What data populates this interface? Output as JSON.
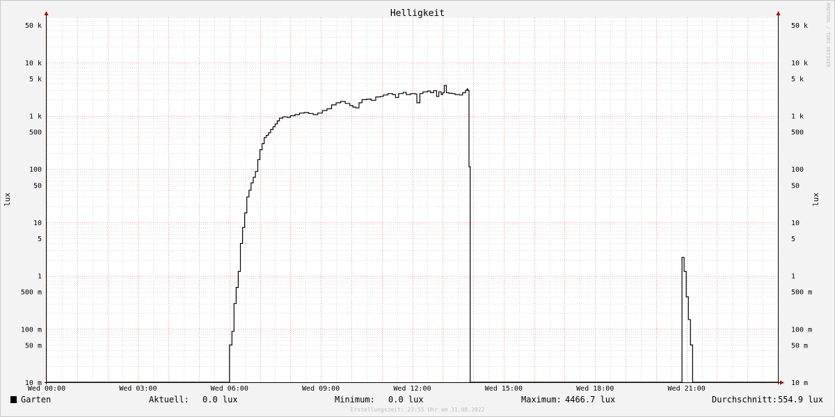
{
  "chart_data": {
    "type": "line",
    "title": "Helligkeit",
    "ylabel": "lux",
    "y_scale": "log",
    "ylim": [
      0.01,
      70000
    ],
    "xlim_hours": [
      0,
      24
    ],
    "x_ticks": [
      {
        "h": 0,
        "label": "Wed 00:00"
      },
      {
        "h": 3,
        "label": "Wed 03:00"
      },
      {
        "h": 6,
        "label": "Wed 06:00"
      },
      {
        "h": 9,
        "label": "Wed 09:00"
      },
      {
        "h": 12,
        "label": "Wed 12:00"
      },
      {
        "h": 15,
        "label": "Wed 15:00"
      },
      {
        "h": 18,
        "label": "Wed 18:00"
      },
      {
        "h": 21,
        "label": "Wed 21:00"
      }
    ],
    "y_ticks": [
      {
        "v": 50000,
        "label": "50 k"
      },
      {
        "v": 10000,
        "label": "10 k"
      },
      {
        "v": 5000,
        "label": "5 k"
      },
      {
        "v": 1000,
        "label": "1 k"
      },
      {
        "v": 500,
        "label": "500"
      },
      {
        "v": 100,
        "label": "100"
      },
      {
        "v": 50,
        "label": "50"
      },
      {
        "v": 10,
        "label": "10"
      },
      {
        "v": 5,
        "label": "5"
      },
      {
        "v": 1,
        "label": "1"
      },
      {
        "v": 0.5,
        "label": "500 m"
      },
      {
        "v": 0.1,
        "label": "100 m"
      },
      {
        "v": 0.05,
        "label": "50 m"
      },
      {
        "v": 0.01,
        "label": "10 m"
      }
    ],
    "grid": true,
    "series": [
      {
        "name": "Garten",
        "color": "#000000",
        "points": [
          [
            0,
            0.01
          ],
          [
            5.98,
            0.01
          ],
          [
            6.0,
            0.05
          ],
          [
            6.08,
            0.09
          ],
          [
            6.15,
            0.3
          ],
          [
            6.22,
            0.6
          ],
          [
            6.29,
            1.2
          ],
          [
            6.36,
            4
          ],
          [
            6.43,
            8
          ],
          [
            6.5,
            15
          ],
          [
            6.57,
            30
          ],
          [
            6.64,
            40
          ],
          [
            6.71,
            55
          ],
          [
            6.78,
            70
          ],
          [
            6.85,
            90
          ],
          [
            6.93,
            150
          ],
          [
            7.0,
            230
          ],
          [
            7.07,
            300
          ],
          [
            7.14,
            390
          ],
          [
            7.21,
            430
          ],
          [
            7.28,
            480
          ],
          [
            7.35,
            550
          ],
          [
            7.43,
            620
          ],
          [
            7.5,
            700
          ],
          [
            7.57,
            800
          ],
          [
            7.64,
            900
          ],
          [
            7.75,
            950
          ],
          [
            7.9,
            930
          ],
          [
            8.0,
            1000
          ],
          [
            8.15,
            1050
          ],
          [
            8.3,
            1120
          ],
          [
            8.45,
            1150
          ],
          [
            8.6,
            1100
          ],
          [
            8.75,
            1050
          ],
          [
            8.9,
            1120
          ],
          [
            9.05,
            1250
          ],
          [
            9.2,
            1350
          ],
          [
            9.35,
            1600
          ],
          [
            9.5,
            1750
          ],
          [
            9.65,
            1850
          ],
          [
            9.8,
            1700
          ],
          [
            9.95,
            1550
          ],
          [
            10.05,
            1450
          ],
          [
            10.15,
            1400
          ],
          [
            10.25,
            1750
          ],
          [
            10.35,
            2000
          ],
          [
            10.5,
            2050
          ],
          [
            10.65,
            1950
          ],
          [
            10.8,
            2250
          ],
          [
            10.95,
            2300
          ],
          [
            11.05,
            2450
          ],
          [
            11.2,
            2600
          ],
          [
            11.35,
            2500
          ],
          [
            11.45,
            2200
          ],
          [
            11.55,
            2600
          ],
          [
            11.7,
            2750
          ],
          [
            11.8,
            2500
          ],
          [
            11.95,
            2600
          ],
          [
            12.1,
            2550
          ],
          [
            12.15,
            1750
          ],
          [
            12.25,
            2600
          ],
          [
            12.35,
            2800
          ],
          [
            12.5,
            2900
          ],
          [
            12.6,
            2700
          ],
          [
            12.7,
            2950
          ],
          [
            12.8,
            2300
          ],
          [
            12.87,
            2800
          ],
          [
            12.95,
            2500
          ],
          [
            13.0,
            2700
          ],
          [
            13.05,
            3700
          ],
          [
            13.12,
            2700
          ],
          [
            13.2,
            2650
          ],
          [
            13.3,
            2600
          ],
          [
            13.4,
            2500
          ],
          [
            13.55,
            2450
          ],
          [
            13.65,
            2700
          ],
          [
            13.75,
            3000
          ],
          [
            13.8,
            3200
          ],
          [
            13.82,
            3000
          ],
          [
            13.86,
            110
          ],
          [
            13.9,
            0.01
          ],
          [
            20.8,
            0.01
          ],
          [
            20.85,
            2.2
          ],
          [
            20.92,
            1.2
          ],
          [
            20.99,
            0.4
          ],
          [
            21.06,
            0.15
          ],
          [
            21.13,
            0.05
          ],
          [
            21.2,
            0.01
          ],
          [
            24,
            0.01
          ]
        ]
      }
    ]
  },
  "legend": {
    "series_name": "Garten",
    "aktuell_label": "Aktuell:",
    "aktuell_value": "0.0 lux",
    "minimum_label": "Minimum:",
    "minimum_value": "0.0 lux",
    "maximum_label": "Maximum:",
    "maximum_value": "4466.7 lux",
    "durchschnitt_label": "Durchschnitt:",
    "durchschnitt_value": "554.9 lux"
  },
  "footer": "Erstellungszeit: 23:55 Uhr am 31.08.2022",
  "watermark": "RRDTOOL / TOBI OETIKER",
  "colors": {
    "background": "#f3f3f3",
    "canvas": "#ffffff",
    "major_grid": "#e8a0a0",
    "minor_grid": "#d8d8d8",
    "axis_arrow": "#aa0000",
    "line": "#000000"
  }
}
